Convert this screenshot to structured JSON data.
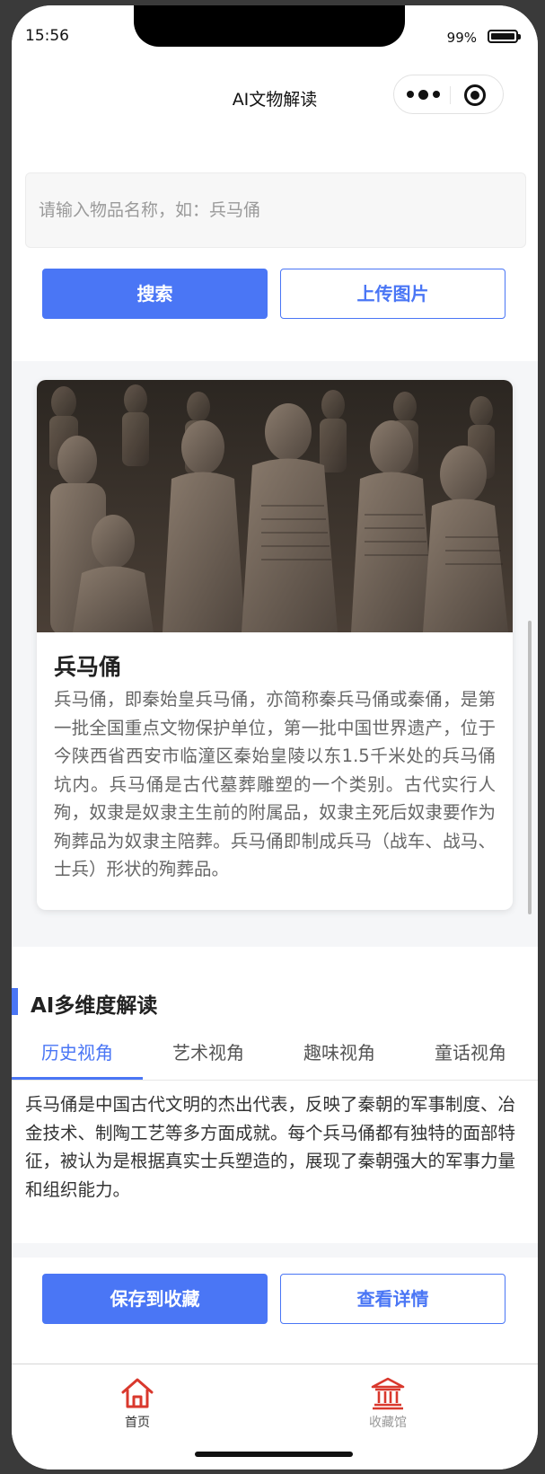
{
  "status_bar": {
    "time": "15:56",
    "battery": "99%"
  },
  "nav": {
    "title": "AI文物解读"
  },
  "search": {
    "placeholder": "请输入物品名称，如：兵马俑",
    "value": "",
    "search_button": "搜索",
    "upload_button": "上传图片"
  },
  "artifact": {
    "name": "兵马俑",
    "description": "兵马俑，即秦始皇兵马俑，亦简称秦兵马俑或秦俑，是第一批全国重点文物保护单位，第一批中国世界遗产，位于今陕西省西安市临潼区秦始皇陵以东1.5千米处的兵马俑坑内。兵马俑是古代墓葬雕塑的一个类别。古代实行人殉，奴隶是奴隶主生前的附属品，奴隶主死后奴隶要作为殉葬品为奴隶主陪葬。兵马俑即制成兵马（战车、战马、士兵）形状的殉葬品。"
  },
  "ai_section": {
    "title": "AI多维度解读",
    "tabs": [
      "历史视角",
      "艺术视角",
      "趣味视角",
      "童话视角"
    ],
    "active_tab": 0,
    "content": "兵马俑是中国古代文明的杰出代表，反映了秦朝的军事制度、冶金技术、制陶工艺等多方面成就。每个兵马俑都有独特的面部特征，被认为是根据真实士兵塑造的，展现了秦朝强大的军事力量和组织能力。"
  },
  "actions": {
    "save_button": "保存到收藏",
    "detail_button": "查看详情"
  },
  "tabbar": {
    "items": [
      {
        "label": "首页",
        "icon": "home-icon"
      },
      {
        "label": "收藏馆",
        "icon": "museum-icon"
      }
    ]
  },
  "colors": {
    "accent": "#4a76f5",
    "tabbar_icon": "#d9382d",
    "text_dark": "#222222",
    "text_muted": "#666666"
  }
}
